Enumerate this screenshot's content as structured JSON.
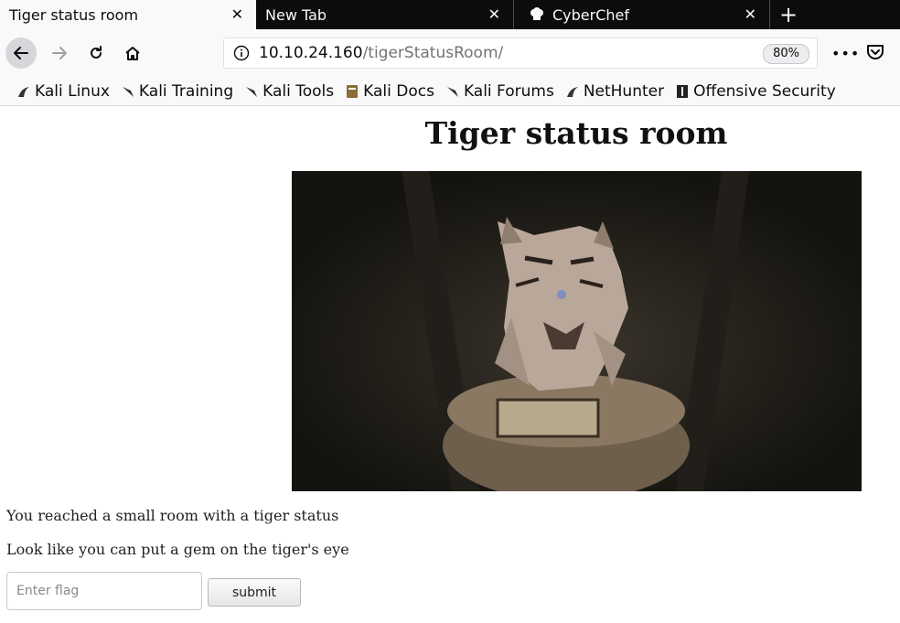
{
  "browser": {
    "tabs": [
      {
        "title": "Tiger status room",
        "active": true,
        "close_icon": "close-icon"
      },
      {
        "title": "New Tab",
        "active": false,
        "close_icon": "close-icon"
      },
      {
        "title": "CyberChef",
        "active": false,
        "icon": "chef-hat-icon",
        "close_icon": "close-icon"
      }
    ],
    "new_tab_symbol": "+",
    "nav_icons": [
      "back-arrow-icon",
      "forward-arrow-icon",
      "reload-icon",
      "home-icon"
    ],
    "url_host": "10.10.24.160",
    "url_path": "/tigerStatusRoom/",
    "zoom": "80%",
    "more_symbol": "•••",
    "toolbar_icons": [
      "more-icon",
      "pocket-icon"
    ],
    "bookmarks": [
      {
        "label": "Kali Linux",
        "icon": "kali-dragon-icon"
      },
      {
        "label": "Kali Training",
        "icon": "kali-dragon-icon"
      },
      {
        "label": "Kali Tools",
        "icon": "kali-dragon-icon"
      },
      {
        "label": "Kali Docs",
        "icon": "docs-icon"
      },
      {
        "label": "Kali Forums",
        "icon": "kali-dragon-icon"
      },
      {
        "label": "NetHunter",
        "icon": "nethunter-icon"
      },
      {
        "label": "Offensive Security",
        "icon": "offsec-icon"
      }
    ],
    "colors": {
      "tabbar": "#0c0c0d",
      "toolbar": "#f9f9fa"
    }
  },
  "page": {
    "title": "Tiger status room",
    "image_subject": "tiger statue bust",
    "paragraph1": "You reached a small room with a tiger status",
    "paragraph2": "Look like you can put a gem on the tiger's eye",
    "flag_placeholder": "Enter flag",
    "submit_label": "submit"
  }
}
